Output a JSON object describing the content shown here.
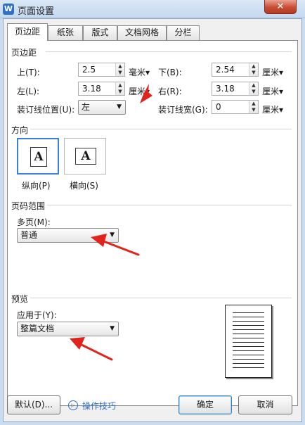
{
  "window": {
    "title": "页面设置",
    "app_logo": "W",
    "close_glyph": "✕"
  },
  "tabs": [
    "页边距",
    "纸张",
    "版式",
    "文档网格",
    "分栏"
  ],
  "margins": {
    "group": "页边距",
    "top": {
      "label": "上(T):",
      "value": "2.5",
      "unit": "毫米"
    },
    "bottom": {
      "label": "下(B):",
      "value": "2.54",
      "unit": "厘米"
    },
    "left": {
      "label": "左(L):",
      "value": "3.18",
      "unit": "厘米"
    },
    "right": {
      "label": "右(R):",
      "value": "3.18",
      "unit": "厘米"
    },
    "gutter_pos": {
      "label": "装订线位置(U):",
      "value": "左"
    },
    "gutter_width": {
      "label": "装订线宽(G):",
      "value": "0",
      "unit": "厘米"
    }
  },
  "orientation": {
    "group": "方向",
    "portrait": {
      "label": "纵向(P)",
      "glyph": "A"
    },
    "landscape": {
      "label": "横向(S)",
      "glyph": "A"
    }
  },
  "pages": {
    "group": "页码范围",
    "label": "多页(M):",
    "value": "普通"
  },
  "preview": {
    "group": "预览",
    "apply_label": "应用于(Y):",
    "apply_value": "整篇文档"
  },
  "footer": {
    "default": "默认(D)...",
    "tips": "操作技巧",
    "ok": "确定",
    "cancel": "取消"
  },
  "icons": {
    "spin_up": "▲",
    "spin_down": "▼",
    "dropdown": "▼",
    "unit_drop": "▾",
    "tip": "▷"
  },
  "colors": {
    "accent": "#2f6fc8",
    "annotation_arrow": "#e0231c",
    "selection_border": "#3c7fd6"
  }
}
